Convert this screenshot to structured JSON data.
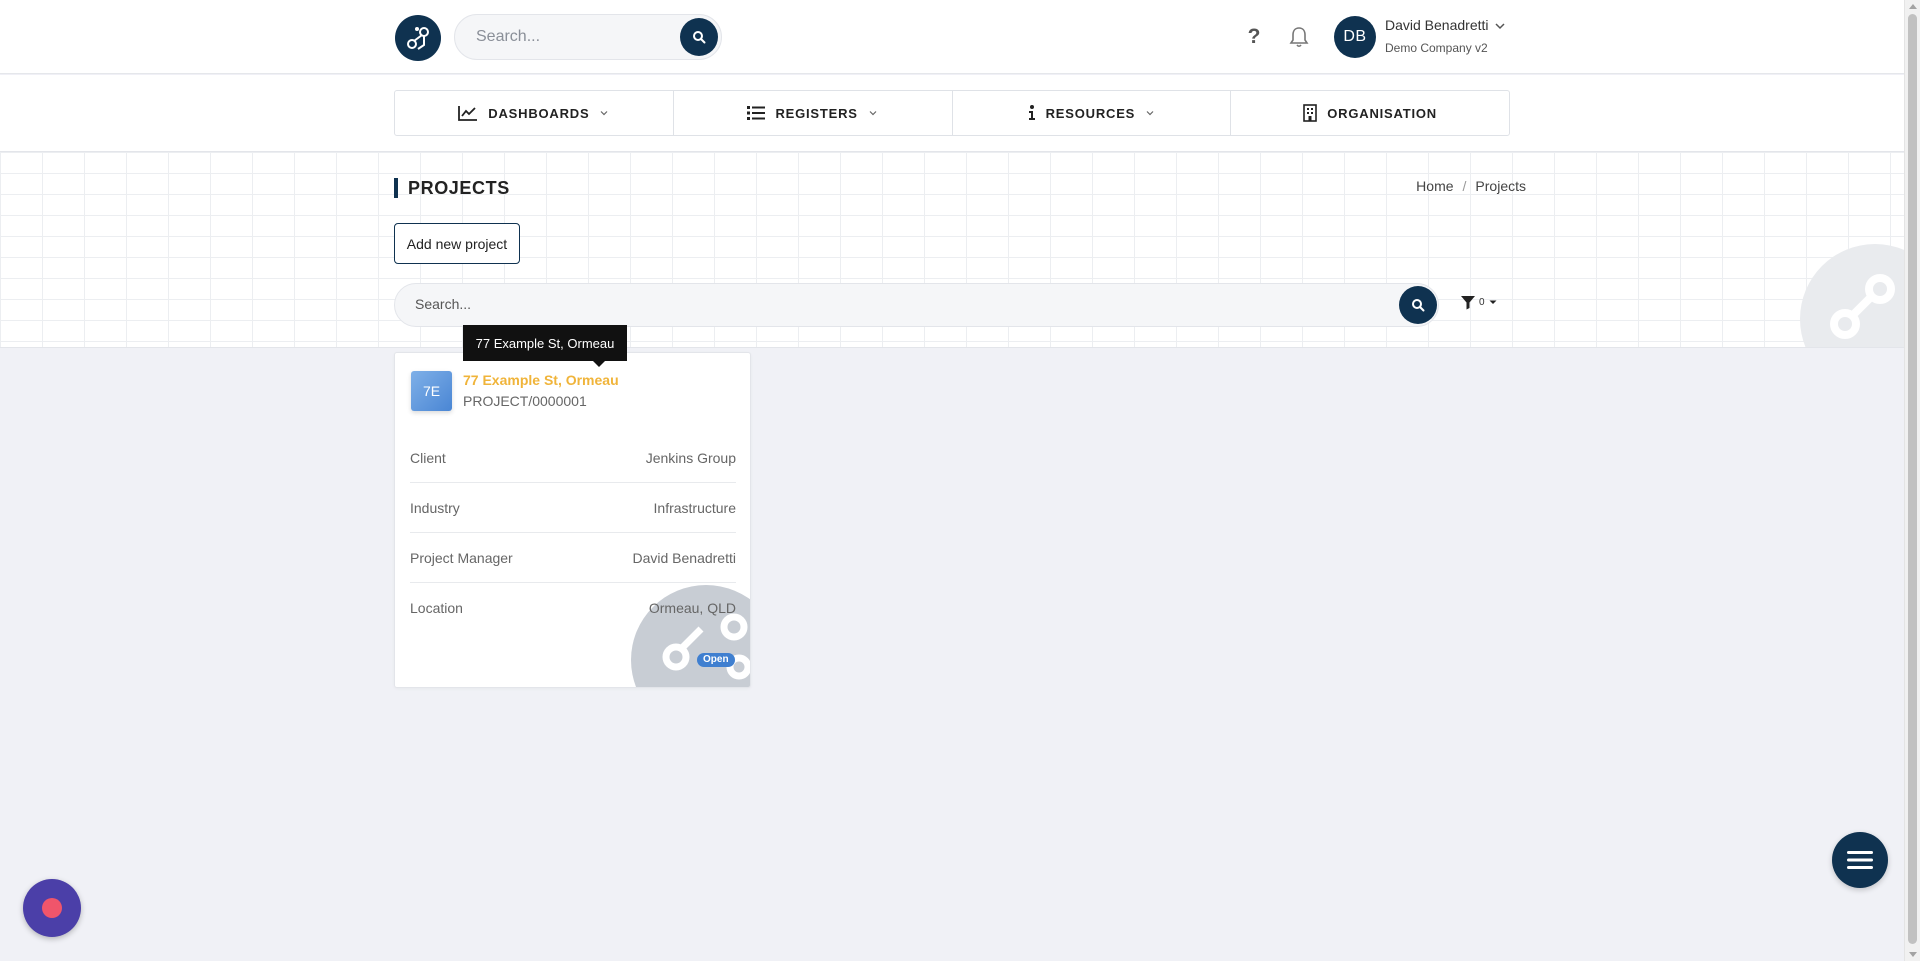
{
  "header": {
    "search_placeholder": "Search...",
    "help_label": "?",
    "user": {
      "initials": "DB",
      "name": "David Benadretti",
      "company": "Demo Company v2"
    }
  },
  "nav": [
    {
      "label": "DASHBOARDS",
      "icon": "chart-line-icon",
      "has_dropdown": true
    },
    {
      "label": "REGISTERS",
      "icon": "list-icon",
      "has_dropdown": true
    },
    {
      "label": "RESOURCES",
      "icon": "info-icon",
      "has_dropdown": true
    },
    {
      "label": "ORGANISATION",
      "icon": "building-icon",
      "has_dropdown": false
    }
  ],
  "page": {
    "title": "PROJECTS",
    "breadcrumb": [
      "Home",
      "Projects"
    ],
    "add_button": "Add new project",
    "search_placeholder": "Search...",
    "filter_count": "0"
  },
  "tooltip": "77 Example St, Ormeau",
  "project": {
    "initials": "7E",
    "title": "77 Example St, Ormeau",
    "code": "PROJECT/0000001",
    "rows": [
      {
        "label": "Client",
        "value": "Jenkins Group"
      },
      {
        "label": "Industry",
        "value": "Infrastructure"
      },
      {
        "label": "Project Manager",
        "value": "David Benadretti"
      },
      {
        "label": "Location",
        "value": "Ormeau, QLD"
      }
    ],
    "status": "Open"
  },
  "colors": {
    "brand": "#0f3250",
    "accent": "#f0b43a",
    "status_open": "#3f7fd0",
    "record": "#4b3fa8"
  }
}
